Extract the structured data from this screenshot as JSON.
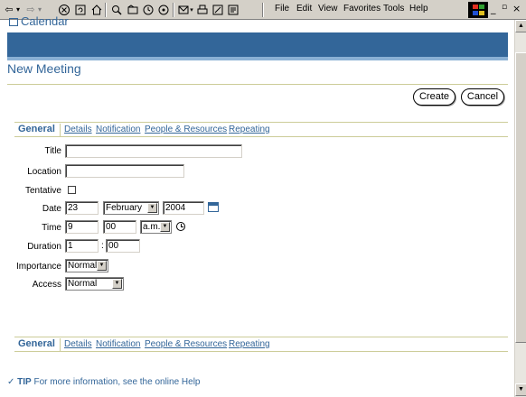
{
  "browser": {
    "menu": [
      "File",
      "Edit",
      "View",
      "Favorites",
      "Tools",
      "Help"
    ],
    "nav_glyphs": [
      "⇦",
      "▾",
      "⇨",
      "▾"
    ],
    "toolbar_icons": [
      "stop-icon",
      "refresh-icon",
      "home-icon",
      "search-icon",
      "favorites-icon",
      "history-icon",
      "media-icon",
      "mail-icon",
      "print-icon",
      "edit-icon",
      "discuss-icon"
    ],
    "window_controls": [
      "_",
      "ö",
      "×"
    ]
  },
  "header": {
    "calendar_link": "Calendar",
    "page_title": "New Meeting"
  },
  "actions": {
    "create": "Create",
    "cancel": "Cancel"
  },
  "tabs": [
    "General",
    "Details",
    "Notification",
    "People & Resources",
    "Repeating"
  ],
  "form": {
    "title": {
      "label": "Title",
      "value": ""
    },
    "location": {
      "label": "Location",
      "value": ""
    },
    "tentative": {
      "label": "Tentative",
      "checked": false
    },
    "date": {
      "label": "Date",
      "day": "23",
      "month": "February",
      "year": "2004"
    },
    "time": {
      "label": "Time",
      "hour": "9",
      "minute": "00",
      "ampm": "a.m."
    },
    "duration": {
      "label": "Duration",
      "hours": "1",
      "separator": ":",
      "minutes": "00"
    },
    "importance": {
      "label": "Importance",
      "value": "Normal"
    },
    "access": {
      "label": "Access",
      "value": "Normal"
    }
  },
  "tip": {
    "label": "TIP",
    "text": "For more information, see the online Help"
  },
  "colors": {
    "brand_blue": "#336699",
    "rule": "#cccc99",
    "chrome": "#d4d0c8"
  }
}
